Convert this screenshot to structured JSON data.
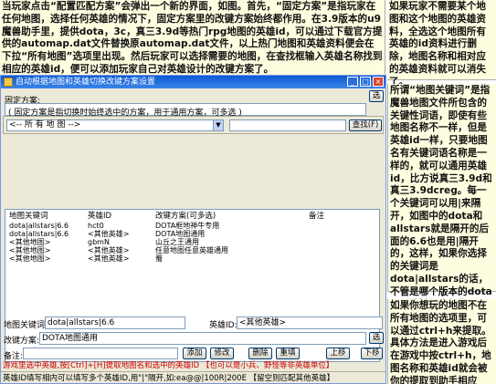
{
  "article": {
    "main_text": "当玩家点击“配置匹配方案”会弹出一个新的界面，如图。首先，“固定方案”是指玩家在任何地图，选择任何英雄的情况下，固定方案里的改键方案始终都作用。在3.9版本的u9魔兽助手里，提供dota，3c，真三3.9d等热门rpg地图的英雄id，可以通过下载官方提供的automap.dat文件替换原automap.dat文件，以上热门地图和英雄资料便会在下拉“所有地图”选项里出现。然后玩家可以选择需要的地图，在查找框输入英雄名称找到相应的英雄id，便可以添加玩家自己对英雄设计的改键方案了。",
    "side_1": "如果玩家不需要某个地图和这个地图的英雄资料，全选这个地图所有英雄的id资料进行删除，地图名称和相对应的英雄资料就可以消失了。",
    "side_2": "所谓“地图关键词”是指魔兽地图文件所包含的关键性词语，即使有些地图名称不一样，但是英雄id一样，只要地图名有关键词语名称是一样的，就可以通用英雄id，比方说真三3.9d和真三3.9dcreg。每一个关键词可以用|来隔开，如图中的dota和allstars就是隔开的后面的6.6也是用|隔开的，这样，如果你选择的关键词是dota|allstars的话，不管是哪个版本的dota图，改键都会起作用，加上6.6就更精确一些。",
    "side_3": "如果你想玩的地图不在所有地图的选项里，可以通过ctrl+h来提取。具体方法是进入游戏后在游戏中按ctrl+h，地图名称和英雄id就会被你的提取到助手相应"
  },
  "dialog": {
    "title": "自动根据地图和英雄切换改键方案设置",
    "fixed_label": "固定方案:",
    "fixed_value": "",
    "fixed_select_btn": "选",
    "fixed_note": "( 固定方案是指切换时始终选中的方案，用于通用方案，可多选 )",
    "map_select_value": "<-- 所 有 地 图 -->",
    "search_value": "",
    "search_btn": "查找(F)",
    "columns": [
      "地图关键词",
      "英雄ID",
      "改键方案(可多选)",
      "备注"
    ],
    "rows": [
      [
        "dota|allstars|6.6",
        "hct0",
        "DOTA框地神牛专用",
        ""
      ],
      [
        "dota|allstars|6.6",
        "<其他英雄>",
        "DOTA地图通用",
        ""
      ],
      [
        "<其他地图>",
        "gbmN",
        "山丘之王通用",
        ""
      ],
      [
        "<其他地图>",
        "<其他英雄>",
        "任意地图任意英雄通用",
        ""
      ],
      [
        "<其他地图>",
        "<其他英雄>",
        "蜀",
        ""
      ]
    ],
    "map_kw_label": "地图关键词:",
    "map_kw_value": "dota|allstars|6.6",
    "hero_id_label": "英雄ID:",
    "hero_id_value": "<其他英雄>",
    "scheme_label": "改键方案:",
    "scheme_value": "DOTA地图通用",
    "scheme_select_btn": "选",
    "remark_label": "备注:",
    "remark_value": "",
    "buttons": {
      "add": "添加",
      "modify": "修改",
      "delete": "删除",
      "reset": "重填",
      "up": "上移",
      "down": "下移"
    },
    "hint_red": "游戏里选中英雄,按[Ctrl]+[H]提取地图名和选中的英雄ID 【也可以是小兵、野怪等非英雄单位】",
    "status": "英雄ID填写相内可以填写多个英雄ID,用\"|\"隔开,如:ea@@|100R|200E 【留空则匹配其他英雄】"
  }
}
